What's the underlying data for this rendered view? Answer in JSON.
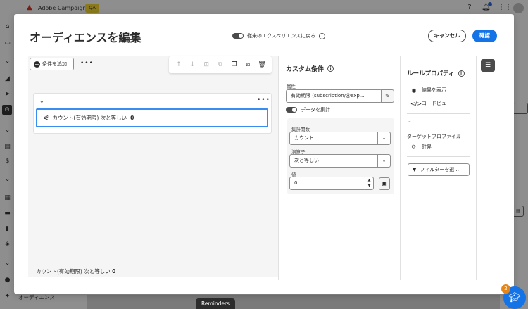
{
  "app": {
    "name": "Adobe Campaign",
    "env_badge": "QA",
    "nav_bottom_label": "オーディエンス",
    "reminders": "Reminders",
    "help_badge": "2"
  },
  "modal": {
    "title": "オーディエンスを編集",
    "legacy_toggle_label": "従来のエクスペリエンスに戻る",
    "cancel_label": "キャンセル",
    "confirm_label": "確認"
  },
  "canvas": {
    "add_condition_label": "条件を追加",
    "condition": {
      "text": "カウント(有効期限) 次と等しい",
      "value": "0"
    },
    "summary_text": "カウント(有効期限) 次と等しい",
    "summary_value": "0"
  },
  "custom_condition": {
    "title": "カスタム条件",
    "attribute_label": "属性",
    "attribute_value": "有効期限 (subscription/@exp...",
    "aggregate_toggle_label": "データを集計",
    "agg_function_label": "集計関数",
    "agg_function_value": "カウント",
    "operator_label": "演算子",
    "operator_value": "次と等しい",
    "value_label": "値",
    "value_value": "0"
  },
  "rule_properties": {
    "title": "ルールプロパティ",
    "show_results_label": "結果を表示",
    "code_view_label": "コードビュー",
    "count_value": "-",
    "target_profile_label": "ターゲットプロファイル",
    "compute_label": "計算",
    "filter_button_label": "フィルターを選..."
  }
}
